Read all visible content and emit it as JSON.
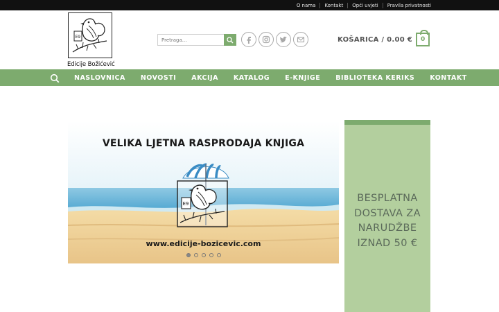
{
  "top_links": [
    "O nama",
    "Kontakt",
    "Opći uvjeti",
    "Pravila privatnosti"
  ],
  "logo": {
    "text": "Edicije Božićević"
  },
  "search": {
    "placeholder": "Pretraga..."
  },
  "socials": [
    "facebook-icon",
    "instagram-icon",
    "twitter-icon",
    "email-icon"
  ],
  "cart": {
    "label": "KOŠARICA / 0.00 €",
    "count": "0"
  },
  "nav": {
    "items": [
      "NASLOVNICA",
      "NOVOSTI",
      "AKCIJA",
      "KATALOG",
      "E-KNJIGE",
      "BIBLIOTEKA KERIKS",
      "KONTAKT"
    ]
  },
  "banner": {
    "title": "VELIKA LJETNA RASPRODAJA KNJIGA",
    "url": "www.edicije-bozicevic.com",
    "slides": 5,
    "active_slide": 1
  },
  "promo": {
    "text": "BESPLATNA DOSTAVA ZA NARUDŽBE IZNAD 50 €"
  },
  "colors": {
    "topbar": "#111111",
    "accent": "#7dab6e",
    "promo_bg": "#b3cf9e",
    "promo_text": "#5b6a5a"
  }
}
